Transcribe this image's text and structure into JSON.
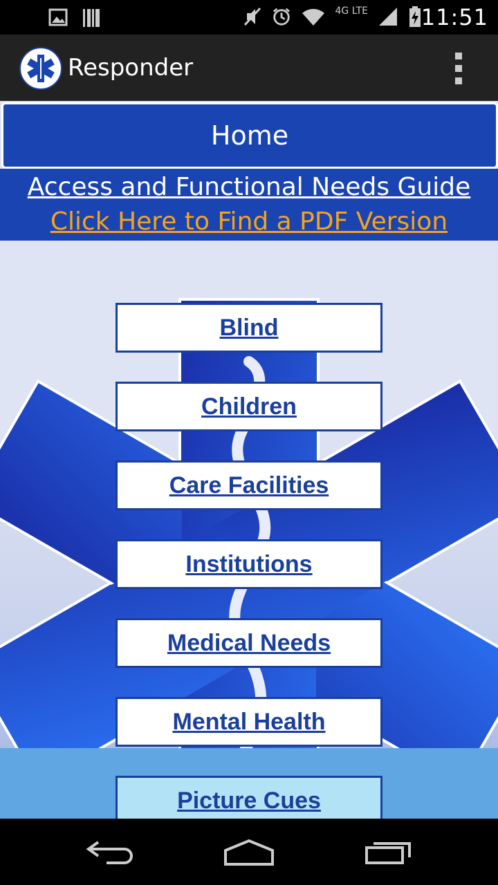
{
  "status_bar": {
    "time": "11:51",
    "network": "4G LTE",
    "icons": [
      "image-icon",
      "barcode-icon",
      "mute-icon",
      "alarm-icon",
      "wifi-icon",
      "signal-icon",
      "battery-charging-icon"
    ]
  },
  "action_bar": {
    "title": "Responder",
    "logo": "star-of-life-logo",
    "overflow_icon": "overflow-menu-icon"
  },
  "home": {
    "label": "Home"
  },
  "guide": {
    "title_link": "Access and Functional Needs Guide",
    "pdf_link": "Click Here to Find a PDF Version"
  },
  "menu": [
    {
      "label": "Blind"
    },
    {
      "label": "Children"
    },
    {
      "label": "Care Facilities"
    },
    {
      "label": "Institutions"
    },
    {
      "label": "Medical Needs"
    },
    {
      "label": "Mental Health"
    },
    {
      "label": "Picture Cues"
    }
  ],
  "nav_bar": {
    "icons": [
      "back-icon",
      "home-icon",
      "recent-apps-icon"
    ]
  },
  "colors": {
    "brand_blue": "#1a44b2",
    "link_orange": "#f7a31a",
    "button_border": "#1a3f9c"
  }
}
